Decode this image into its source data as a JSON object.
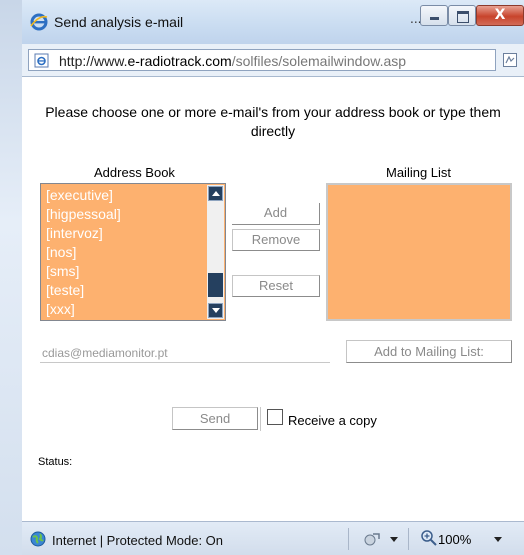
{
  "window": {
    "title": "Send analysis e-mail",
    "title_ellipsis": "...",
    "close_label": "X"
  },
  "address_bar": {
    "url_prefix": "http://www.",
    "url_domain": "e-radiotrack.com",
    "url_path": "/solfiles/solemailwindow.asp"
  },
  "form": {
    "instructions": "Please choose one or more e-mail's from your address book or type them directly",
    "address_book_label": "Address Book",
    "mailing_list_label": "Mailing List",
    "address_book_items": [
      "[executive]",
      "[higpessoal]",
      "[intervoz]",
      "[nos]",
      "[sms]",
      "[teste]",
      "[xxx]"
    ],
    "mailing_list_items": [],
    "add_label": "Add",
    "remove_label": "Remove",
    "reset_label": "Reset",
    "email_value": "cdias@mediamonitor.pt",
    "add_to_mailing_label": "Add to Mailing List:",
    "send_label": "Send",
    "receive_copy_label": "Receive a copy",
    "receive_copy_checked": false,
    "status_label": "Status:"
  },
  "statusbar": {
    "zone_text": "Internet | Protected Mode: On",
    "zoom_text": "100%"
  },
  "colors": {
    "list_background": "#fdb16f",
    "list_text": "#ffffff",
    "scroll_accent": "#25405f"
  }
}
